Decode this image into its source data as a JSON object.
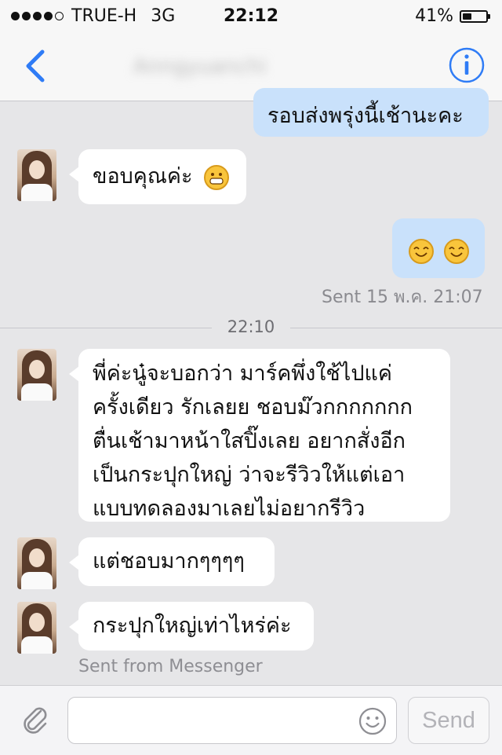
{
  "status_bar": {
    "carrier": "TRUE-H",
    "network": "3G",
    "time": "22:12",
    "battery": "41%",
    "battery_level": 0.41
  },
  "header": {
    "contact_name": "Anngyuanchi"
  },
  "messages": [
    {
      "from": "me",
      "text": "รอบส่งพรุ่งนี้เช้านะคะ"
    },
    {
      "from": "them",
      "text": "ขอบคุณค่ะ"
    },
    {
      "from": "me",
      "emoji": "smiling-face-icon"
    },
    {
      "status": "Sent 15 พ.ค. 21:07"
    },
    {
      "divider": "22:10"
    },
    {
      "from": "them",
      "lines": [
        "พี่ค่ะนู๋จะบอกว่า มาร์คพึ่งใช้ไปแค่",
        "ครั้งเดียว รักเลยย ชอบม๊วกกกกกกก",
        "ตื่นเช้ามาหน้าใสปิ๊งเลย อยากสั่งอีก",
        "เป็นกระปุกใหญ่ ว่าจะรีวิวให้แต่เอา",
        "แบบทดลองมาเลยไม่อยากรีวิว"
      ]
    },
    {
      "from": "them",
      "text": "แต่ชอบมากๆๆๆๆ"
    },
    {
      "from": "them",
      "text": "กระปุกใหญ่เท่าไหร่ค่ะ"
    },
    {
      "status": "Sent from Messenger"
    }
  ],
  "composer": {
    "placeholder": "",
    "send_label": "Send"
  }
}
